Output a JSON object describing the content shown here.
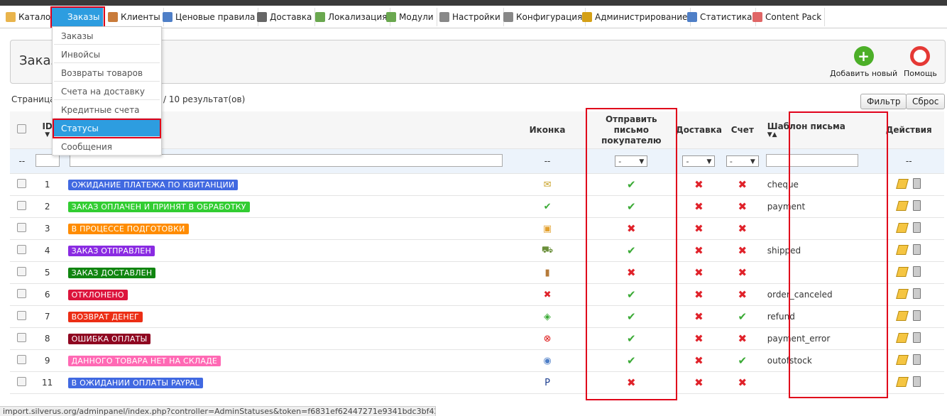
{
  "menu": [
    {
      "label": "Каталог",
      "icon": "folder-icon",
      "color": "#e9b44c"
    },
    {
      "label": "Заказы",
      "icon": "cart-icon",
      "color": "#2d9de0",
      "active": true
    },
    {
      "label": "Клиенты",
      "icon": "user-icon",
      "color": "#c97b3a"
    },
    {
      "label": "Ценовые правила",
      "icon": "calculator-icon",
      "color": "#4f7fc7"
    },
    {
      "label": "Доставка",
      "icon": "truck-icon",
      "color": "#666"
    },
    {
      "label": "Локализация",
      "icon": "globe-icon",
      "color": "#6aa84f"
    },
    {
      "label": "Модули",
      "icon": "puzzle-icon",
      "color": "#6aa84f"
    },
    {
      "label": "Настройки",
      "icon": "settings-icon",
      "color": "#888"
    },
    {
      "label": "Конфигурация",
      "icon": "wrench-icon",
      "color": "#888"
    },
    {
      "label": "Администрирование",
      "icon": "key-icon",
      "color": "#d4a017"
    },
    {
      "label": "Статистика",
      "icon": "chart-icon",
      "color": "#4f7fc7"
    },
    {
      "label": "Content Pack",
      "icon": "grid-icon",
      "color": "#e06666"
    }
  ],
  "dropdown": [
    {
      "label": "Заказы"
    },
    {
      "label": "Инвойсы"
    },
    {
      "label": "Возвраты товаров"
    },
    {
      "label": "Счета на доставку"
    },
    {
      "label": "Кредитные счета"
    },
    {
      "label": "Статусы",
      "active": true
    },
    {
      "label": "Сообщения"
    }
  ],
  "panel": {
    "title": "Заказ",
    "add_label": "Добавить новый",
    "help_label": "Помощь"
  },
  "pager": {
    "prefix": "Страница",
    "rest": "/ 10 результат(ов)"
  },
  "buttons": {
    "filter": "Фильтр",
    "reset": "Сброс"
  },
  "columns": {
    "id": "ID",
    "icon": "Иконка",
    "send_email": "Отправить письмо покупателю",
    "delivery": "Доставка",
    "invoice": "Счет",
    "template": "Шаблон письма",
    "actions": "Действия"
  },
  "filters": {
    "dash": "--",
    "select_value": "-"
  },
  "rows": [
    {
      "id": "1",
      "name": "ОЖИДАНИЕ ПЛАТЕЖА ПО КВИТАНЦИИ",
      "color": "#4169e1",
      "icon": "cheque-icon",
      "send": true,
      "delivery": false,
      "invoice": false,
      "template": "cheque"
    },
    {
      "id": "2",
      "name": "ЗАКАЗ ОПЛАЧЕН И ПРИНЯТ В ОБРАБОТКУ",
      "color": "#32cd32",
      "icon": "checkmark-icon",
      "send": true,
      "delivery": false,
      "invoice": false,
      "template": "payment"
    },
    {
      "id": "3",
      "name": "В ПРОЦЕССЕ ПОДГОТОВКИ",
      "color": "#ff8c00",
      "icon": "box-icon",
      "send": false,
      "delivery": false,
      "invoice": false,
      "template": ""
    },
    {
      "id": "4",
      "name": "ЗАКАЗ ОТПРАВЛЕН",
      "color": "#8a2be2",
      "icon": "truck-icon",
      "send": true,
      "delivery": false,
      "invoice": false,
      "template": "shipped"
    },
    {
      "id": "5",
      "name": "ЗАКАЗ ДОСТАВЛЕН",
      "color": "#108510",
      "icon": "door-icon",
      "send": false,
      "delivery": false,
      "invoice": false,
      "template": ""
    },
    {
      "id": "6",
      "name": "ОТКЛОНЕНО",
      "color": "#dc143c",
      "icon": "cross-icon",
      "send": true,
      "delivery": false,
      "invoice": false,
      "template": "order_canceled"
    },
    {
      "id": "7",
      "name": "ВОЗВРАТ ДЕНЕГ",
      "color": "#ec2e15",
      "icon": "money-icon",
      "send": true,
      "delivery": false,
      "invoice": true,
      "template": "refund"
    },
    {
      "id": "8",
      "name": "ОШИБКА ОПЛАТЫ",
      "color": "#8f0621",
      "icon": "error-icon",
      "send": true,
      "delivery": false,
      "invoice": false,
      "template": "payment_error"
    },
    {
      "id": "9",
      "name": "ДАННОГО ТОВАРА НЕТ НА СКЛАДЕ",
      "color": "#ff69b4",
      "icon": "stock-icon",
      "send": true,
      "delivery": false,
      "invoice": true,
      "template": "outofstock"
    },
    {
      "id": "11",
      "name": "В ОЖИДАНИИ ОПЛАТЫ PAYPAL",
      "color": "#4169e1",
      "icon": "paypal-icon",
      "send": false,
      "delivery": false,
      "invoice": false,
      "template": ""
    }
  ],
  "statusbar": "import.silverus.org/adminpanel/index.php?controller=AdminStatuses&token=f6831ef62447271e9341bdc3bf42e000#"
}
